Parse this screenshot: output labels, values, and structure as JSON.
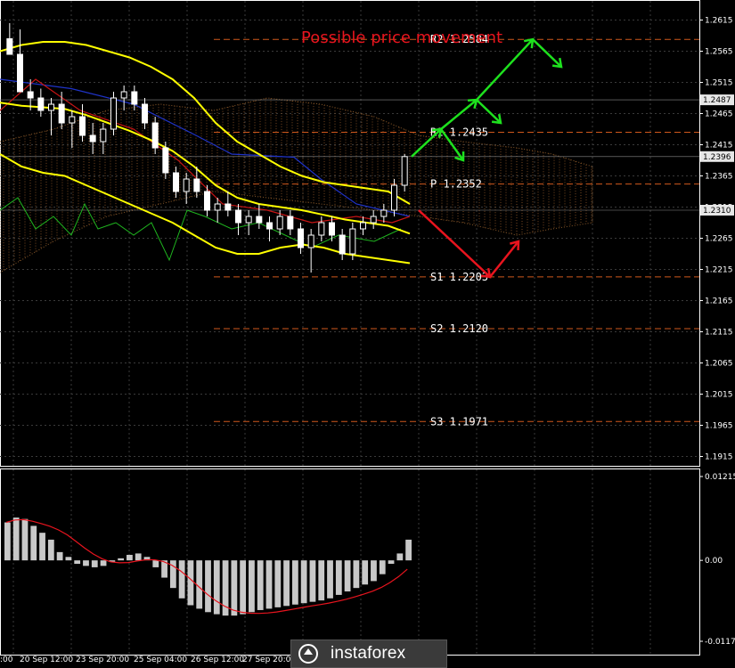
{
  "chart_data": {
    "type": "candlestick",
    "title": "Possible price movement",
    "price_axis": {
      "ticks": [
        "1.2615",
        "1.2565",
        "1.2515",
        "1.2465",
        "1.2415",
        "1.2365",
        "1.2315",
        "1.2265",
        "1.2215",
        "1.2165",
        "1.2115",
        "1.2065",
        "1.2015",
        "1.1965",
        "1.1915"
      ],
      "range": [
        1.1915,
        1.2615
      ]
    },
    "price_tags": [
      {
        "value": "1.2487",
        "y_value": 1.2487
      },
      {
        "value": "1.2396",
        "y_value": 1.2396
      },
      {
        "value": "1.2310",
        "y_value": 1.231
      }
    ],
    "pivot_levels": [
      {
        "label": "R2 1.2584",
        "value": 1.2584
      },
      {
        "label": "R1 1.2435",
        "value": 1.2435
      },
      {
        "label": "P 1.2352",
        "value": 1.2352
      },
      {
        "label": "S1 1.2203",
        "value": 1.2203
      },
      {
        "label": "S2 1.2120",
        "value": 1.212
      },
      {
        "label": "S3 1.1971",
        "value": 1.1971
      }
    ],
    "time_axis": [
      "20 Sep 12:00",
      "23 Sep 20:00",
      "25 Sep 04:00",
      "26 Sep 12:00",
      "27 Sep 20:00"
    ],
    "time_axis_partial": ":00",
    "macd_axis": {
      "ticks": [
        "0.01215",
        "0.00",
        "-0.01172"
      ],
      "range": [
        -0.01172,
        0.01215
      ]
    },
    "candles": [
      [
        1.2585,
        1.261,
        1.257,
        1.256
      ],
      [
        1.256,
        1.26,
        1.253,
        1.25
      ],
      [
        1.25,
        1.252,
        1.247,
        1.249
      ],
      [
        1.249,
        1.2505,
        1.246,
        1.247
      ],
      [
        1.247,
        1.249,
        1.243,
        1.248
      ],
      [
        1.248,
        1.25,
        1.244,
        1.245
      ],
      [
        1.245,
        1.247,
        1.241,
        1.246
      ],
      [
        1.246,
        1.248,
        1.242,
        1.243
      ],
      [
        1.243,
        1.245,
        1.24,
        1.242
      ],
      [
        1.242,
        1.245,
        1.24,
        1.244
      ],
      [
        1.244,
        1.25,
        1.243,
        1.249
      ],
      [
        1.249,
        1.251,
        1.247,
        1.25
      ],
      [
        1.25,
        1.251,
        1.247,
        1.248
      ],
      [
        1.248,
        1.249,
        1.244,
        1.245
      ],
      [
        1.245,
        1.246,
        1.24,
        1.241
      ],
      [
        1.241,
        1.242,
        1.236,
        1.237
      ],
      [
        1.237,
        1.238,
        1.233,
        1.234
      ],
      [
        1.234,
        1.237,
        1.232,
        1.236
      ],
      [
        1.236,
        1.238,
        1.233,
        1.234
      ],
      [
        1.234,
        1.235,
        1.23,
        1.231
      ],
      [
        1.231,
        1.233,
        1.229,
        1.232
      ],
      [
        1.232,
        1.234,
        1.23,
        1.231
      ],
      [
        1.231,
        1.232,
        1.227,
        1.229
      ],
      [
        1.229,
        1.231,
        1.227,
        1.23
      ],
      [
        1.23,
        1.232,
        1.228,
        1.229
      ],
      [
        1.229,
        1.23,
        1.226,
        1.228
      ],
      [
        1.228,
        1.231,
        1.227,
        1.23
      ],
      [
        1.23,
        1.231,
        1.227,
        1.228
      ],
      [
        1.228,
        1.229,
        1.224,
        1.225
      ],
      [
        1.225,
        1.228,
        1.221,
        1.227
      ],
      [
        1.227,
        1.23,
        1.226,
        1.229
      ],
      [
        1.229,
        1.23,
        1.226,
        1.227
      ],
      [
        1.227,
        1.228,
        1.223,
        1.224
      ],
      [
        1.224,
        1.229,
        1.223,
        1.228
      ],
      [
        1.228,
        1.23,
        1.227,
        1.229
      ],
      [
        1.229,
        1.231,
        1.228,
        1.23
      ],
      [
        1.23,
        1.232,
        1.229,
        1.231
      ],
      [
        1.231,
        1.236,
        1.23,
        1.235
      ],
      [
        1.235,
        1.24,
        1.234,
        1.2396
      ]
    ],
    "bollinger": {
      "upper": [
        1.2565,
        1.2575,
        1.258,
        1.258,
        1.2575,
        1.2565,
        1.2555,
        1.254,
        1.252,
        1.249,
        1.245,
        1.242,
        1.24,
        1.238,
        1.2365,
        1.2355,
        1.235,
        1.2345,
        1.234,
        1.232
      ],
      "lower": [
        1.24,
        1.238,
        1.237,
        1.2365,
        1.235,
        1.2335,
        1.232,
        1.2305,
        1.229,
        1.227,
        1.225,
        1.224,
        1.224,
        1.225,
        1.2255,
        1.225,
        1.224,
        1.2235,
        1.223,
        1.2225
      ]
    },
    "forecast": {
      "bullish": [
        1.2396,
        1.244,
        1.2487,
        1.2584
      ],
      "bearish": [
        1.231,
        1.2203,
        1.226
      ]
    },
    "macd_histogram": [
      0.0055,
      0.0062,
      0.006,
      0.005,
      0.004,
      0.003,
      0.0012,
      0.0005,
      -0.0005,
      -0.0008,
      -0.001,
      -0.0008,
      -0.0002,
      0.0003,
      0.0008,
      0.001,
      0.0005,
      -0.001,
      -0.0025,
      -0.004,
      -0.0055,
      -0.0065,
      -0.007,
      -0.0075,
      -0.0078,
      -0.008,
      -0.008,
      -0.0078,
      -0.0075,
      -0.0072,
      -0.007,
      -0.0068,
      -0.0066,
      -0.0064,
      -0.0062,
      -0.006,
      -0.0058,
      -0.0055,
      -0.005,
      -0.0045,
      -0.004,
      -0.0035,
      -0.003,
      -0.002,
      -0.0005,
      0.001,
      0.003
    ],
    "colors": {
      "bull": "#ffffff",
      "bear": "#ffffff",
      "signal": "#e8141e",
      "bands": "#ffff00",
      "forecast_up": "#1ee11e",
      "forecast_down": "#e8141e",
      "pivot": "#d0581c"
    }
  },
  "brand": {
    "name": "instaforex"
  }
}
